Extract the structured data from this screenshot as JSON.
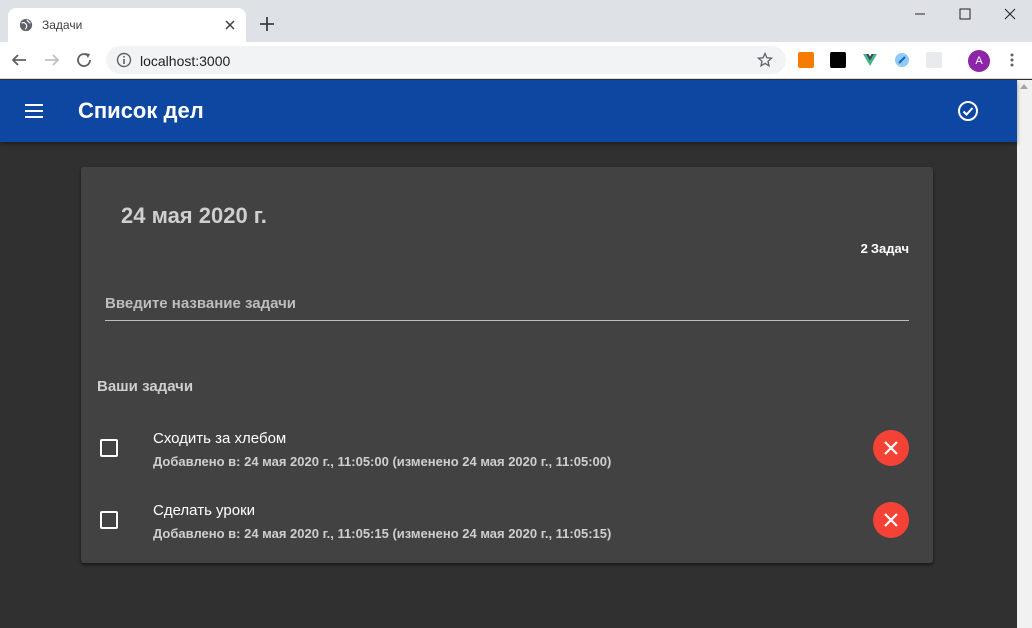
{
  "browser": {
    "tab_title": "Задачи",
    "url": "localhost:3000",
    "profile_initial": "A"
  },
  "app": {
    "title": "Список дел",
    "date": "24 мая 2020 г.",
    "task_count": "2",
    "task_count_label": "Задач",
    "input_placeholder": "Введите название задачи",
    "section_title": "Ваши задачи",
    "tasks": [
      {
        "title": "Сходить за хлебом",
        "meta": "Добавлено в: 24 мая 2020 г., 11:05:00 (изменено 24 мая 2020 г., 11:05:00)",
        "done": false
      },
      {
        "title": "Сделать уроки",
        "meta": "Добавлено в: 24 мая 2020 г., 11:05:15 (изменено 24 мая 2020 г., 11:05:15)",
        "done": false
      }
    ]
  },
  "colors": {
    "appbar": "#0d47a1",
    "background": "#303030",
    "card": "#424242",
    "delete_button": "#f44336"
  }
}
